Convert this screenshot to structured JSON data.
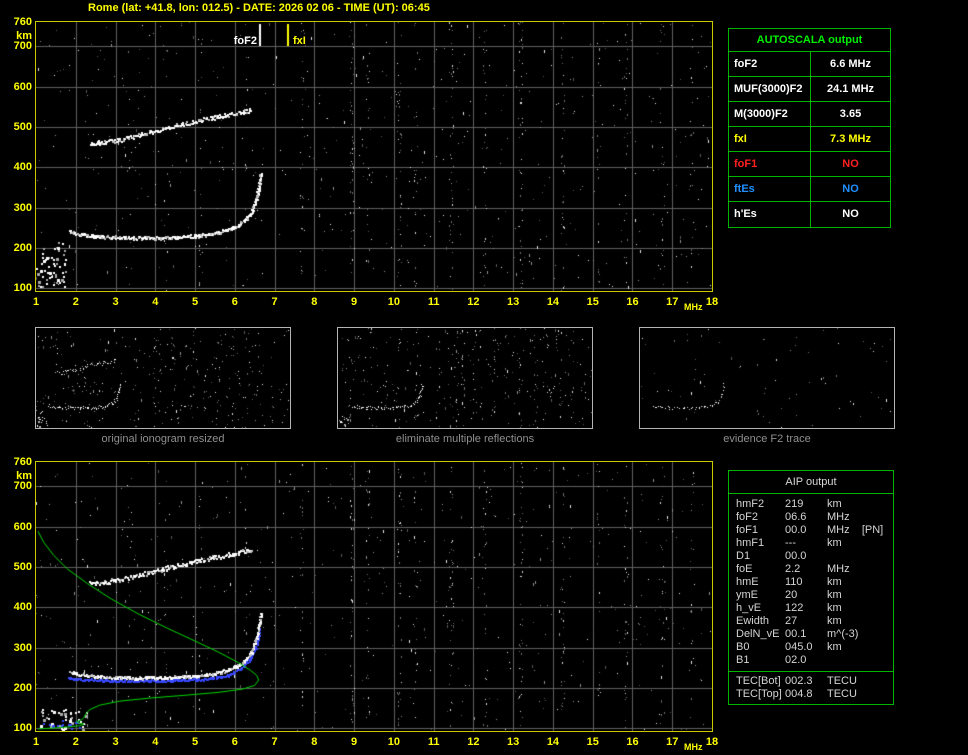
{
  "title": "Rome (lat: +41.8, lon: 012.5) - DATE: 2026 02 06 - TIME (UT): 06:45",
  "main_plot": {
    "fof2_label": "foF2",
    "fxi_label": "fxI"
  },
  "autoscala_table": {
    "title": "AUTOSCALA output",
    "rows": [
      {
        "label": "foF2",
        "value": "6.6 MHz",
        "color": "#ffffff"
      },
      {
        "label": "MUF(3000)F2",
        "value": "24.1 MHz",
        "color": "#ffffff"
      },
      {
        "label": "M(3000)F2",
        "value": "3.65",
        "color": "#ffffff"
      },
      {
        "label": "fxI",
        "value": "7.3 MHz",
        "color": "#ffff00"
      },
      {
        "label": "foF1",
        "value": "NO",
        "color": "#ff2020"
      },
      {
        "label": "ftEs",
        "value": "NO",
        "color": "#2090ff"
      },
      {
        "label": "h'Es",
        "value": "NO",
        "color": "#ffffff"
      }
    ]
  },
  "thumbnails": [
    {
      "caption": "original ionogram resized"
    },
    {
      "caption": "eliminate multiple reflections"
    },
    {
      "caption": "evidence F2 trace"
    }
  ],
  "aip_table": {
    "title": "AIP output",
    "rows": [
      {
        "label": "hmF2",
        "value": "219",
        "unit": "km"
      },
      {
        "label": "foF2",
        "value": "06.6",
        "unit": "MHz"
      },
      {
        "label": "foF1",
        "value": "00.0",
        "unit": "MHz    [PN]"
      },
      {
        "label": "hmF1",
        "value": "---",
        "unit": "km"
      },
      {
        "label": "D1",
        "value": "00.0",
        "unit": ""
      },
      {
        "label": "foE",
        "value": "2.2",
        "unit": "MHz"
      },
      {
        "label": "hmE",
        "value": "110",
        "unit": "km"
      },
      {
        "label": "ymE",
        "value": "20",
        "unit": "km"
      },
      {
        "label": "h_vE",
        "value": "122",
        "unit": "km"
      },
      {
        "label": "Ewidth",
        "value": "27",
        "unit": "km"
      },
      {
        "label": "DelN_vE",
        "value": "00.1",
        "unit": "m^(-3)"
      },
      {
        "label": "B0",
        "value": "045.0",
        "unit": "km"
      },
      {
        "label": "B1",
        "value": "02.0",
        "unit": ""
      }
    ],
    "tec_rows": [
      {
        "label": "TEC[Bot]",
        "value": "002.3",
        "unit": "TECU"
      },
      {
        "label": "TEC[Top]",
        "value": "004.8",
        "unit": "TECU"
      }
    ]
  },
  "chart_data": {
    "type": "scatter",
    "title": "Ionogram: virtual height (km) vs sounding frequency (MHz)",
    "x_axis": {
      "label": "MHz",
      "min": 1,
      "max": 18,
      "ticks": [
        1,
        2,
        3,
        4,
        5,
        6,
        7,
        8,
        9,
        10,
        11,
        12,
        13,
        14,
        15,
        16,
        17,
        18
      ]
    },
    "y_axis": {
      "label": "km",
      "min": 93,
      "max": 760,
      "ticks": [
        760,
        700,
        600,
        500,
        400,
        300,
        200,
        100
      ],
      "grid": [
        100,
        200,
        300,
        400,
        500,
        600,
        700
      ]
    },
    "markers": {
      "foF2_mhz": 6.6,
      "fxI_mhz": 7.3
    },
    "traces": {
      "f2_first_order": [
        [
          1.85,
          240
        ],
        [
          2.1,
          233
        ],
        [
          2.5,
          228
        ],
        [
          3,
          226
        ],
        [
          3.5,
          225
        ],
        [
          4,
          225
        ],
        [
          4.5,
          226
        ],
        [
          5,
          229
        ],
        [
          5.4,
          234
        ],
        [
          5.8,
          243
        ],
        [
          6.1,
          256
        ],
        [
          6.3,
          272
        ],
        [
          6.45,
          295
        ],
        [
          6.55,
          325
        ],
        [
          6.62,
          358
        ],
        [
          6.66,
          385
        ]
      ],
      "f2_second_order": [
        [
          2.35,
          458
        ],
        [
          2.7,
          462
        ],
        [
          3.1,
          468
        ],
        [
          3.5,
          477
        ],
        [
          3.9,
          487
        ],
        [
          4.3,
          497
        ],
        [
          4.7,
          507
        ],
        [
          5.1,
          516
        ],
        [
          5.5,
          524
        ],
        [
          5.9,
          532
        ],
        [
          6.2,
          538
        ],
        [
          6.4,
          543
        ]
      ],
      "restored_blue": [
        [
          1.8,
          224
        ],
        [
          2.5,
          219
        ],
        [
          3.5,
          217
        ],
        [
          4.5,
          218
        ],
        [
          5.2,
          221
        ],
        [
          5.8,
          230
        ],
        [
          6.15,
          247
        ],
        [
          6.4,
          275
        ],
        [
          6.55,
          308
        ],
        [
          6.62,
          350
        ]
      ],
      "profile_green": [
        [
          1.05,
          588
        ],
        [
          1.2,
          560
        ],
        [
          1.45,
          528
        ],
        [
          1.8,
          494
        ],
        [
          2.3,
          458
        ],
        [
          2.9,
          420
        ],
        [
          3.6,
          382
        ],
        [
          4.3,
          348
        ],
        [
          5,
          316
        ],
        [
          5.6,
          288
        ],
        [
          6.1,
          262
        ],
        [
          6.4,
          243
        ],
        [
          6.55,
          231
        ],
        [
          6.6,
          219
        ],
        [
          6.5,
          206
        ],
        [
          6.2,
          197
        ],
        [
          5.6,
          189
        ],
        [
          4.8,
          182
        ],
        [
          3.9,
          175
        ],
        [
          3.1,
          167
        ],
        [
          2.6,
          157
        ],
        [
          2.35,
          146
        ],
        [
          2.25,
          135
        ],
        [
          2.2,
          125
        ],
        [
          2.15,
          121
        ],
        [
          2.02,
          116
        ],
        [
          2.1,
          112
        ],
        [
          2.2,
          110
        ],
        [
          2.1,
          106
        ],
        [
          1.8,
          103
        ],
        [
          1.4,
          100
        ],
        [
          1.05,
          98
        ]
      ]
    },
    "noise_columns": [
      {
        "mhz": 3.35,
        "d": 0.18
      },
      {
        "mhz": 4.25,
        "d": 0.22
      },
      {
        "mhz": 5.15,
        "d": 0.25
      },
      {
        "mhz": 6.3,
        "d": 0.2
      },
      {
        "mhz": 7.7,
        "d": 0.45
      },
      {
        "mhz": 8.95,
        "d": 0.75
      },
      {
        "mhz": 9.35,
        "d": 0.4
      },
      {
        "mhz": 10.15,
        "d": 0.55
      },
      {
        "mhz": 10.55,
        "d": 0.35
      },
      {
        "mhz": 11.45,
        "d": 0.65
      },
      {
        "mhz": 12.3,
        "d": 0.45
      },
      {
        "mhz": 13.2,
        "d": 0.7
      },
      {
        "mhz": 14.25,
        "d": 0.55
      },
      {
        "mhz": 15.15,
        "d": 0.3
      },
      {
        "mhz": 15.85,
        "d": 0.45
      },
      {
        "mhz": 16.75,
        "d": 0.35
      },
      {
        "mhz": 17.5,
        "d": 0.25
      }
    ],
    "noise_clusters_top": [
      {
        "f0": 1,
        "f1": 1.75,
        "h0": 100,
        "h1": 215,
        "n": 55
      }
    ],
    "noise_clusters_bottom": [
      {
        "f0": 1,
        "f1": 2.3,
        "h0": 95,
        "h1": 148,
        "n": 40
      },
      {
        "f0": 1.2,
        "f1": 2.2,
        "h0": 100,
        "h1": 125,
        "n": 14,
        "col": "#3848ff"
      }
    ]
  }
}
